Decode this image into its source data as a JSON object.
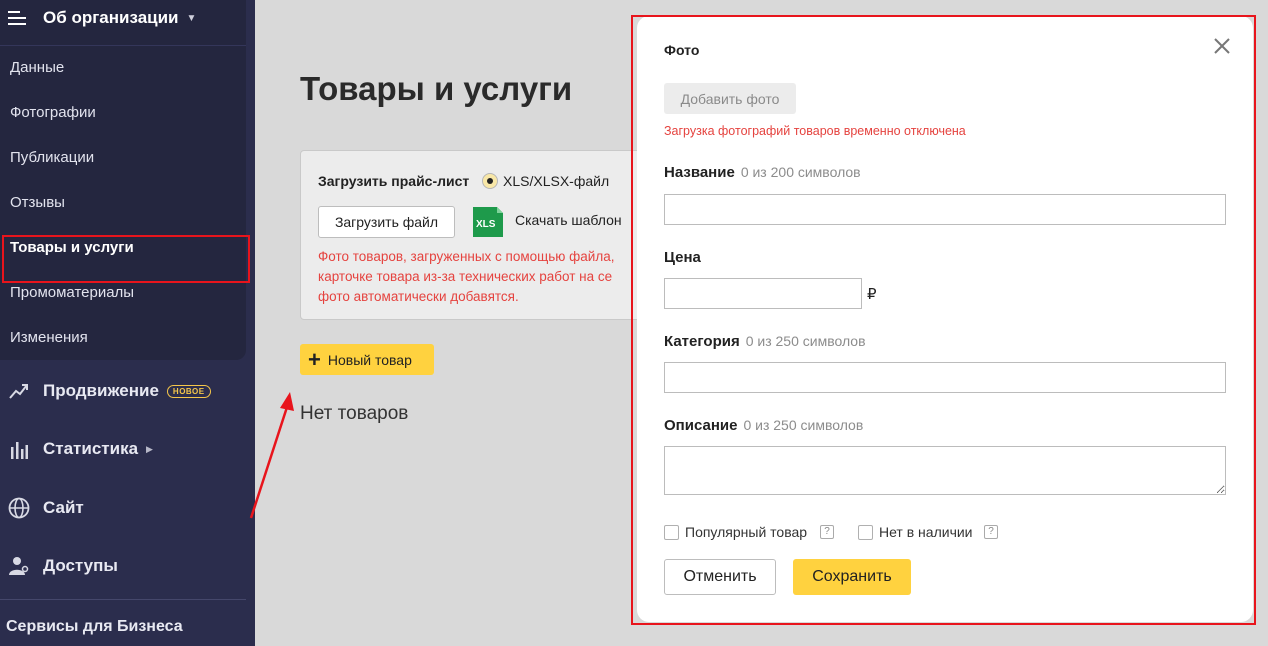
{
  "sidebar": {
    "org_title": "Об организации",
    "items": [
      {
        "label": "Данные"
      },
      {
        "label": "Фотографии"
      },
      {
        "label": "Публикации"
      },
      {
        "label": "Отзывы"
      },
      {
        "label": "Товары и услуги",
        "active": true
      },
      {
        "label": "Промоматериалы"
      },
      {
        "label": "Изменения"
      }
    ],
    "sections": [
      {
        "label": "Продвижение",
        "badge": "НОВОЕ",
        "icon": "trend-icon"
      },
      {
        "label": "Статистика",
        "icon": "stats-icon"
      },
      {
        "label": "Сайт",
        "icon": "globe-icon"
      },
      {
        "label": "Доступы",
        "icon": "user-key-icon"
      }
    ],
    "services_label": "Сервисы для Бизнеса"
  },
  "main": {
    "title": "Товары и услуги",
    "upload": {
      "label": "Загрузить прайс-лист",
      "format": "XLS/XLSX-файл",
      "upload_button": "Загрузить файл",
      "xls_badge": "XLS",
      "template_button": "Скачать шаблон",
      "warning_lines": [
        "Фото товаров, загруженных с помощью файла,",
        "карточке товара из-за технических работ на се",
        "фото автоматически добавятся."
      ]
    },
    "new_item_button": "Новый товар",
    "empty_text": "Нет товаров"
  },
  "modal": {
    "photo_label": "Фото",
    "add_photo_button": "Добавить фото",
    "photo_warning": "Загрузка фотографий товаров временно отключена",
    "name_label": "Название",
    "name_hint": "0 из 200 символов",
    "name_value": "",
    "price_label": "Цена",
    "price_value": "",
    "currency": "₽",
    "category_label": "Категория",
    "category_hint": "0 из 250 символов",
    "category_value": "",
    "description_label": "Описание",
    "description_hint": "0 из 250 символов",
    "popular_label": "Популярный товар",
    "out_of_stock_label": "Нет в наличии",
    "help_mark": "?",
    "cancel_button": "Отменить",
    "save_button": "Сохранить"
  },
  "colors": {
    "sidebar_bg": "#2b2d4d",
    "accent_yellow": "#ffd23f",
    "warning_red": "#e5433f",
    "highlight_red": "#e8141c"
  }
}
